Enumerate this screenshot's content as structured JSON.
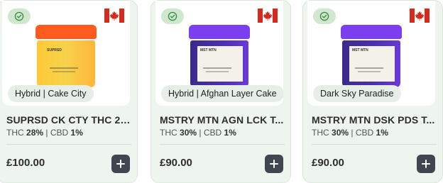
{
  "products": [
    {
      "strain_label": "Hybrid | Cake City",
      "name": "SUPRSD CK CTY THC 28...",
      "thc_label": "THC",
      "thc_value": "28%",
      "separator": "|",
      "cbd_label": "CBD",
      "cbd_value": "1%",
      "price": "£100.00",
      "jar_text": "SUPRSD",
      "icons": {
        "verified": "check-circle-icon",
        "flag": "canada-flag-icon",
        "add": "plus-icon"
      }
    },
    {
      "strain_label": "Hybrid | Afghan Layer Cake",
      "name": "MSTRY MTN AGN LCK T...",
      "thc_label": "THC",
      "thc_value": "30%",
      "separator": "|",
      "cbd_label": "CBD",
      "cbd_value": "1%",
      "price": "£90.00",
      "jar_text": "MST MTN",
      "icons": {
        "verified": "check-circle-icon",
        "flag": "canada-flag-icon",
        "add": "plus-icon"
      }
    },
    {
      "strain_label": "Dark Sky Paradise",
      "name": "MSTRY MTN DSK PDS T...",
      "thc_label": "THC",
      "thc_value": "30%",
      "separator": "|",
      "cbd_label": "CBD",
      "cbd_value": "1%",
      "price": "£90.00",
      "jar_text": "MST MTN",
      "icons": {
        "verified": "check-circle-icon",
        "flag": "canada-flag-icon",
        "add": "plus-icon"
      }
    }
  ],
  "colors": {
    "card_bg": "#eef4ee",
    "badge_bg": "#cfe8cf",
    "badge_icon": "#3f8f4a",
    "button_bg": "#3f4650",
    "flag_red": "#d52b1e"
  }
}
